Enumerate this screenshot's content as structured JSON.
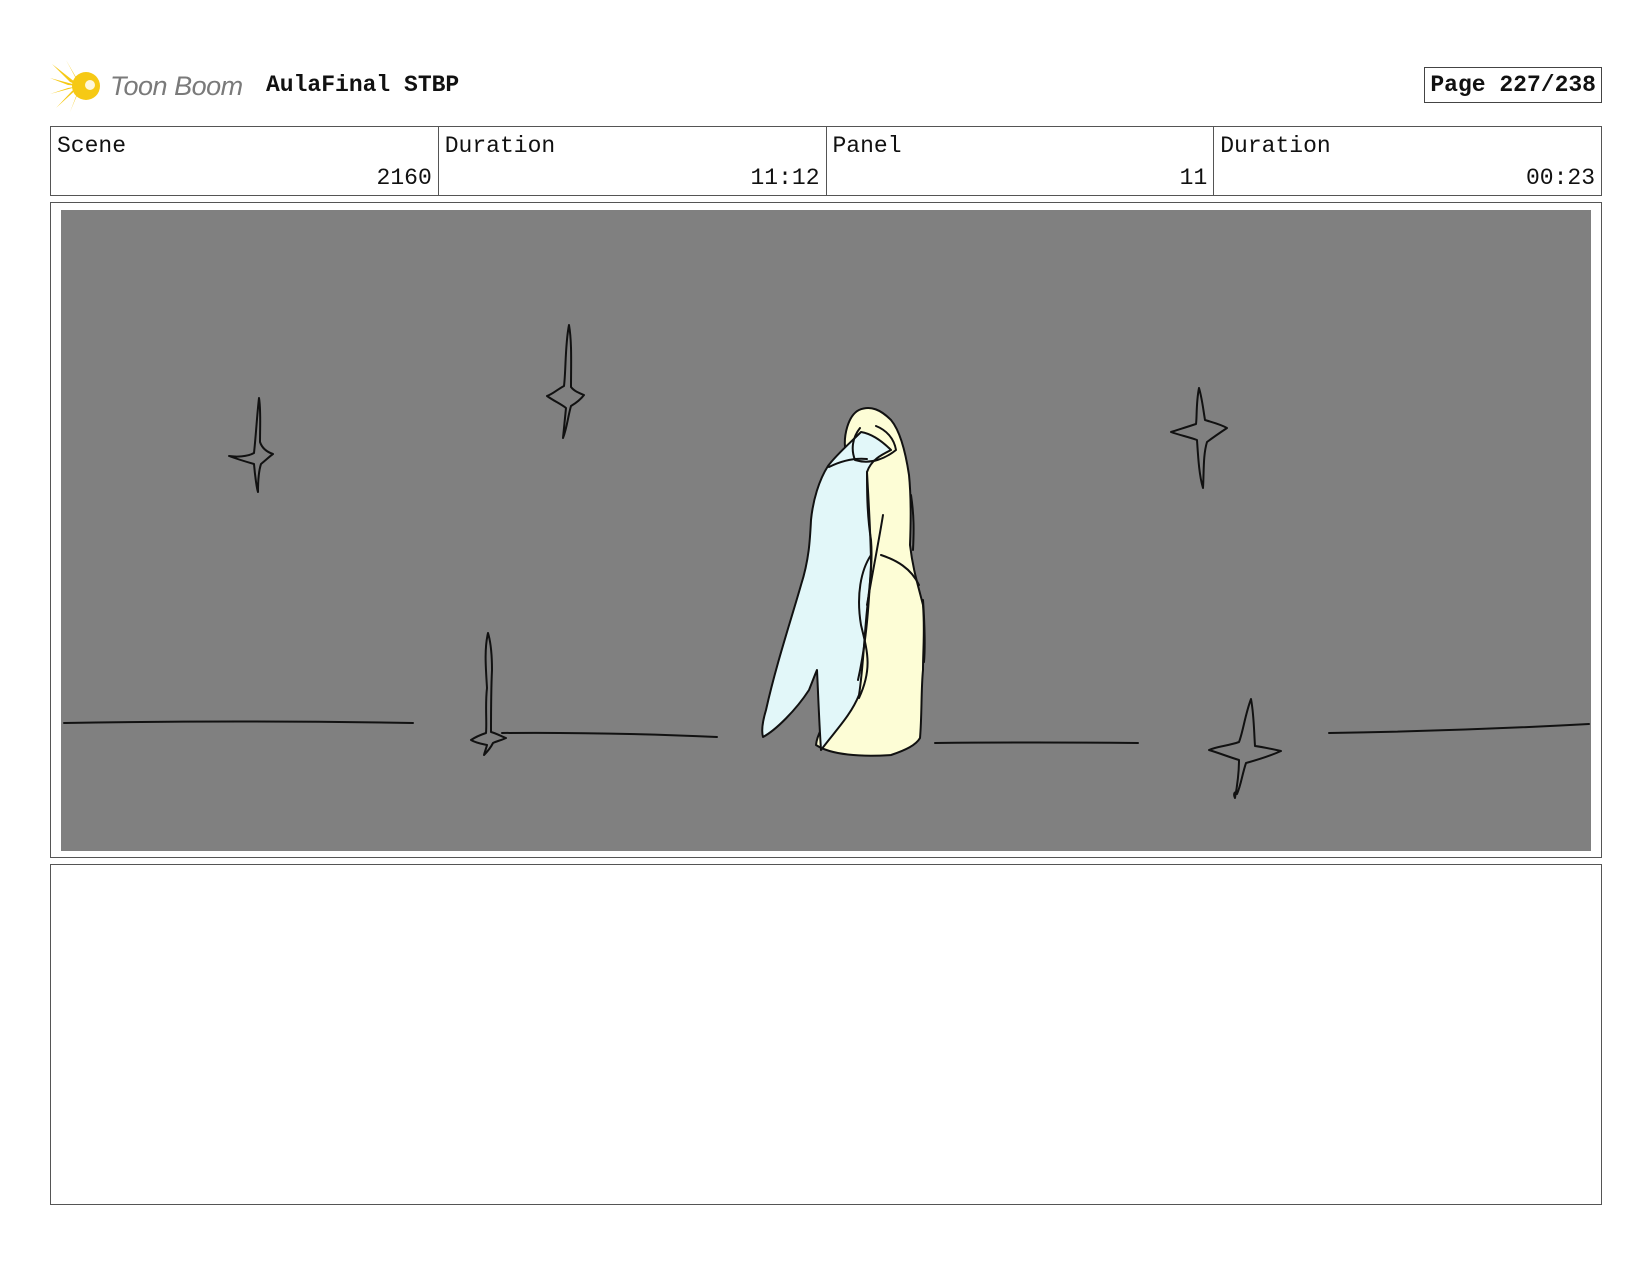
{
  "header": {
    "logo_text": "Toon Boom",
    "project_title": "AulaFinal STBP",
    "page_label": "Page 227/238"
  },
  "info": [
    {
      "label": "Scene",
      "value": "2160"
    },
    {
      "label": "Duration",
      "value": "11:12"
    },
    {
      "label": "Panel",
      "value": "11"
    },
    {
      "label": "Duration",
      "value": "00:23"
    }
  ],
  "panel": {
    "background_color": "#808080",
    "figure_colors": {
      "cloak_light_blue": "#e2f7f9",
      "robe_pale_yellow": "#fdfdd6",
      "line": "#111111"
    }
  },
  "notes": {
    "text": ""
  },
  "colors": {
    "logo_yellow": "#f6c915",
    "logo_gray": "#7a7a7a",
    "border": "#555555"
  }
}
